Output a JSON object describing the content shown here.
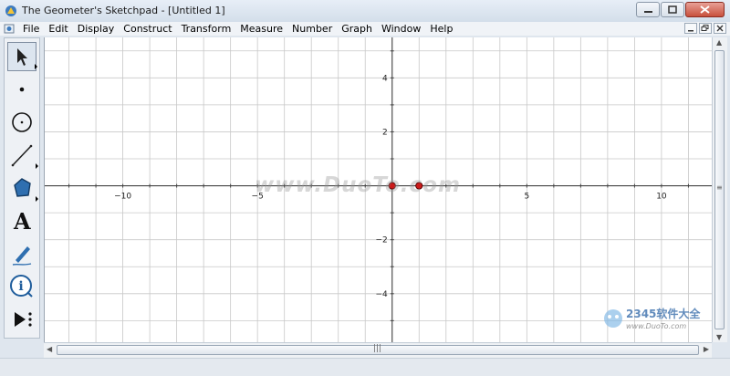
{
  "window": {
    "title": "The Geometer's Sketchpad - [Untitled 1]"
  },
  "menu": {
    "items": [
      "File",
      "Edit",
      "Display",
      "Construct",
      "Transform",
      "Measure",
      "Number",
      "Graph",
      "Window",
      "Help"
    ]
  },
  "toolbox": {
    "tools": [
      {
        "name": "arrow-tool",
        "icon": "arrow-icon",
        "selected": true
      },
      {
        "name": "point-tool",
        "icon": "point-icon"
      },
      {
        "name": "compass-tool",
        "icon": "compass-icon"
      },
      {
        "name": "straightedge-tool",
        "icon": "straightedge-icon"
      },
      {
        "name": "polygon-tool",
        "icon": "polygon-icon"
      },
      {
        "name": "text-tool",
        "icon": "text-icon",
        "glyph": "A"
      },
      {
        "name": "marker-tool",
        "icon": "marker-icon"
      },
      {
        "name": "information-tool",
        "icon": "information-icon"
      },
      {
        "name": "custom-tool",
        "icon": "custom-tool-icon"
      }
    ]
  },
  "graph": {
    "x_ticks": [
      "−10",
      "−5",
      "5",
      "10"
    ],
    "y_ticks": [
      "4",
      "2",
      "−2",
      "−4"
    ],
    "x_tick_values": [
      -10,
      -5,
      5,
      10
    ],
    "y_tick_values": [
      4,
      2,
      -2,
      -4
    ],
    "x_range": [
      -12.9,
      11.9
    ],
    "y_range": [
      -5.8,
      5.5
    ],
    "grid": true,
    "points": [
      {
        "x": 0,
        "y": 0
      },
      {
        "x": 1,
        "y": 0
      }
    ],
    "point_color": "#cc1a1a"
  },
  "watermark": {
    "text": "www.DuoTo.com",
    "badge": "2345软件大全",
    "badge_url": "www.DuoTo.com"
  },
  "colors": {
    "grid": "#c8c8c8",
    "axis": "#444444"
  }
}
